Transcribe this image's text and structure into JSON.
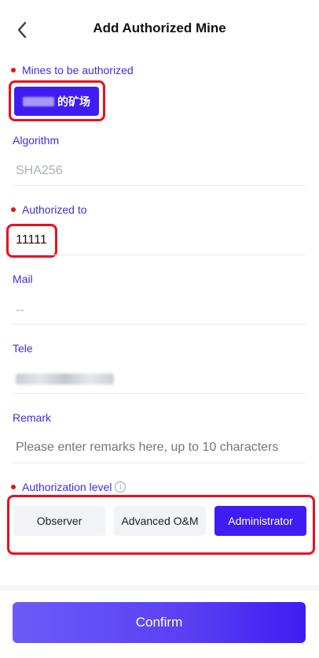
{
  "header": {
    "title": "Add Authorized Mine",
    "back_icon": "chevron-left-icon"
  },
  "mines": {
    "label": "Mines to be authorized",
    "chip_text": "的矿场"
  },
  "algorithm": {
    "label": "Algorithm",
    "value": "SHA256"
  },
  "authorized_to": {
    "label": "Authorized to",
    "value": "11111"
  },
  "mail": {
    "label": "Mail",
    "value": "--"
  },
  "tele": {
    "label": "Tele"
  },
  "remark": {
    "label": "Remark",
    "placeholder": "Please enter remarks here, up to 10 characters"
  },
  "authorization_level": {
    "label": "Authorization level",
    "options": [
      "Observer",
      "Advanced O&M",
      "Administrator"
    ],
    "selected": "Administrator"
  },
  "confirm_label": "Confirm",
  "colors": {
    "accent": "#3f1cf2",
    "required": "#e8101f",
    "label": "#3b2ee0",
    "highlight": "#e8101f"
  }
}
